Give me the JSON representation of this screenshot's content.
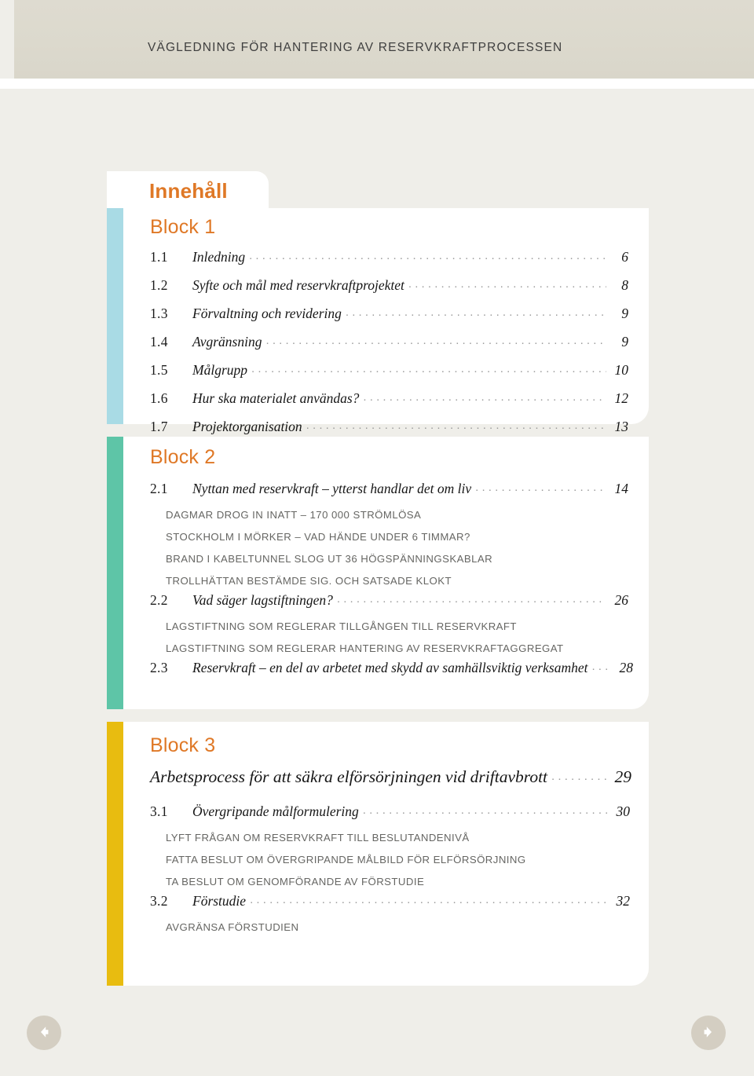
{
  "header": {
    "title": "VÄGLEDNING FÖR HANTERING AV RESERVKRAFTPROCESSEN"
  },
  "toc": {
    "tab_label": "Innehåll"
  },
  "colors": {
    "accent_orange": "#df7826",
    "block1_bar": "#a9dbe5",
    "block2_bar": "#5ec5a7",
    "block3_bar": "#e8bc10",
    "page_bg": "#efeee9",
    "header_band": "#dcd9cd",
    "nav_button": "#d4cec2"
  },
  "blocks": [
    {
      "heading": "Block 1",
      "entries": [
        {
          "num": "1.1",
          "title": "Inledning",
          "page": "6"
        },
        {
          "num": "1.2",
          "title": "Syfte och mål med reservkraftprojektet",
          "page": "8"
        },
        {
          "num": "1.3",
          "title": "Förvaltning och revidering",
          "page": "9"
        },
        {
          "num": "1.4",
          "title": "Avgränsning",
          "page": "9"
        },
        {
          "num": "1.5",
          "title": "Målgrupp",
          "page": "10"
        },
        {
          "num": "1.6",
          "title": "Hur ska materialet användas?",
          "page": "12"
        },
        {
          "num": "1.7",
          "title": "Projektorganisation",
          "page": "13"
        }
      ]
    },
    {
      "heading": "Block 2",
      "entries": [
        {
          "num": "2.1",
          "title": "Nyttan med reservkraft – ytterst handlar det om liv",
          "page": "14",
          "subs": [
            "DAGMAR DROG IN INATT – 170 000 STRÖMLÖSA",
            "STOCKHOLM I MÖRKER – VAD HÄNDE UNDER 6 TIMMAR?",
            "BRAND I KABELTUNNEL SLOG UT 36 HÖGSPÄNNINGSKABLAR",
            "TROLLHÄTTAN BESTÄMDE SIG. OCH SATSADE KLOKT"
          ]
        },
        {
          "num": "2.2",
          "title": "Vad säger lagstiftningen?",
          "page": "26",
          "subs": [
            "LAGSTIFTNING SOM REGLERAR TILLGÅNGEN TILL RESERVKRAFT",
            "LAGSTIFTNING SOM REGLERAR HANTERING AV RESERVKRAFTAGGREGAT"
          ]
        },
        {
          "num": "2.3",
          "title": "Reservkraft – en del av arbetet med skydd av samhällsviktig verksamhet",
          "page": "28"
        }
      ]
    },
    {
      "heading": "Block 3",
      "main_entry": {
        "title": "Arbetsprocess för att säkra elförsörjningen vid driftavbrott",
        "page": "29"
      },
      "entries": [
        {
          "num": "3.1",
          "title": "Övergripande målformulering",
          "page": "30",
          "subs": [
            "LYFT FRÅGAN OM RESERVKRAFT TILL BESLUTANDENIVÅ",
            "FATTA BESLUT OM ÖVERGRIPANDE MÅLBILD FÖR ELFÖRSÖRJNING",
            "TA BESLUT OM GENOMFÖRANDE AV FÖRSTUDIE"
          ]
        },
        {
          "num": "3.2",
          "title": "Förstudie",
          "page": "32",
          "subs": [
            "AVGRÄNSA FÖRSTUDIEN"
          ]
        }
      ]
    }
  ],
  "nav": {
    "prev_label": "previous-page",
    "next_label": "next-page"
  }
}
